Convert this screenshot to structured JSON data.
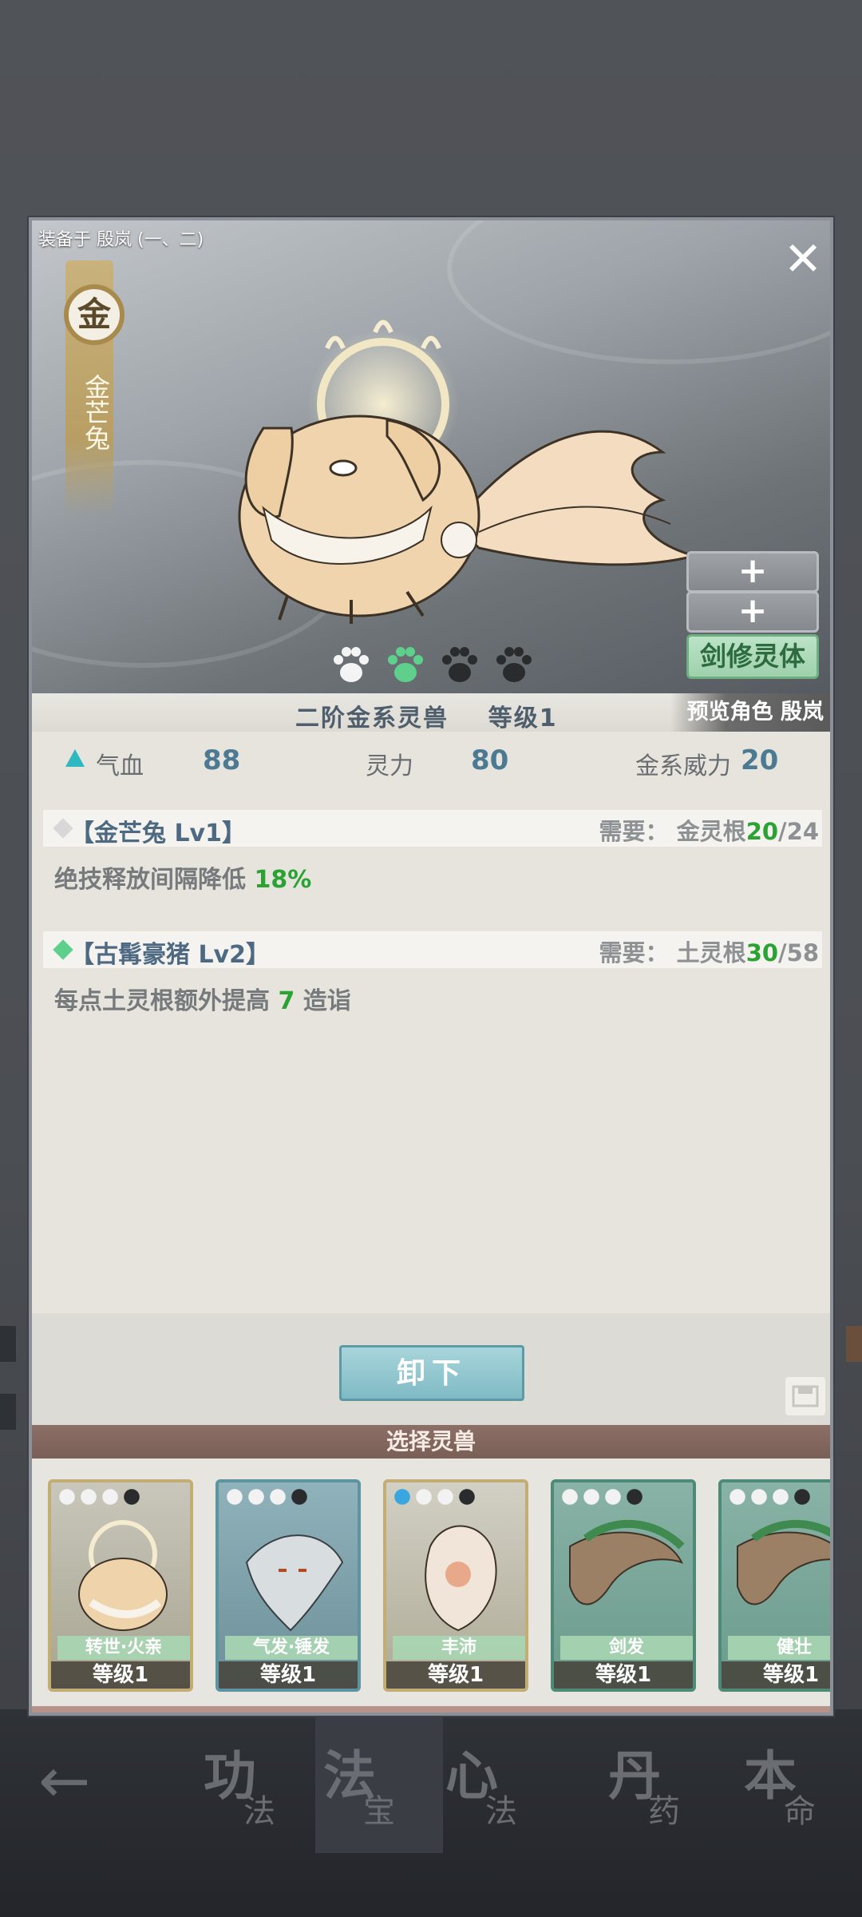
{
  "equipped_label": "装备于 殷岚 (一、二)",
  "beast": {
    "element": "金",
    "name_vertical": "金芒兔",
    "tier_text": "二阶金系灵兽",
    "level_text": "等级1",
    "preview_text": "预览角色 殷岚",
    "paw_rating": {
      "filled": 1,
      "total": 4
    }
  },
  "side_buttons": {
    "plus_1": "+",
    "plus_2": "+",
    "sword_body": "剑修灵体"
  },
  "stats": [
    {
      "label": "气血",
      "value": "88"
    },
    {
      "label": "灵力",
      "value": "80"
    },
    {
      "label": "金系威力",
      "value": "20"
    }
  ],
  "skills": [
    {
      "name": "【金芒兔 Lv1】",
      "need_label": "需要：",
      "need_root": "金灵根",
      "need_have": "20",
      "need_total": "/24",
      "desc_prefix": "绝技释放间隔降低",
      "desc_value": "18%",
      "desc_suffix": "",
      "active": false
    },
    {
      "name": "【古髯豪猪 Lv2】",
      "need_label": "需要：",
      "need_root": "土灵根",
      "need_have": "30",
      "need_total": "/58",
      "desc_prefix": "每点土灵根额外提高",
      "desc_value": "7",
      "desc_suffix": "造诣",
      "active": true
    }
  ],
  "unequip_label": "卸下",
  "select_header": "选择灵兽",
  "cards": [
    {
      "tag": "转世·火亲",
      "level": "等级1",
      "paws_filled": 0
    },
    {
      "tag": "气发·锤发",
      "level": "等级1",
      "paws_filled": 0
    },
    {
      "tag": "丰沛",
      "level": "等级1",
      "paws_filled": 1
    },
    {
      "tag": "剑发",
      "level": "等级1",
      "paws_filled": 0
    },
    {
      "tag": "健壮",
      "level": "等级1",
      "paws_filled": 0
    }
  ],
  "bottom_nav": [
    {
      "big": "功",
      "small": "法"
    },
    {
      "big": "法",
      "small": "宝"
    },
    {
      "big": "心",
      "small": "法"
    },
    {
      "big": "丹",
      "small": "药"
    },
    {
      "big": "本",
      "small": "命"
    }
  ],
  "colors": {
    "accent_green": "#2aa332",
    "teal": "#2db8c2",
    "stat_blue": "#4b7a92"
  }
}
